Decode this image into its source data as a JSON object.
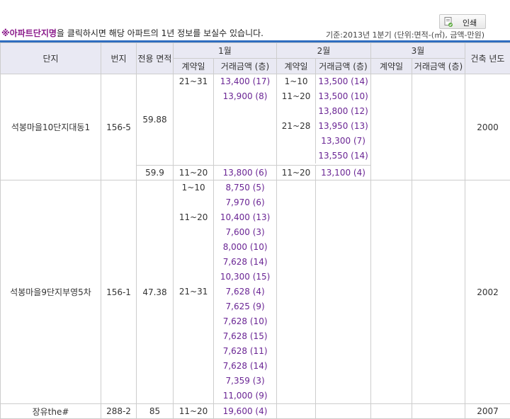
{
  "toolbar": {
    "print_label": "인쇄"
  },
  "notice": {
    "highlight": "※아파트단지명",
    "rest": "을 클릭하시면 해당 아파트의 1년 정보를 보실수 있습니다."
  },
  "basis": {
    "text": "기준:2013년 1분기   (단위:면적-(㎡), 금액-만원)"
  },
  "headers": {
    "complex": "단지",
    "lot": "번지",
    "area": "전용 면적",
    "jan": "1월",
    "feb": "2월",
    "mar": "3월",
    "built": "건축 년도",
    "contract_day": "계약일",
    "price_floor": "거래금액 (층)"
  },
  "rows": {
    "r1": {
      "name": "석봉마을10단지대동1",
      "lot": "156-5",
      "area_a": "59.88",
      "area_b": "59.9",
      "built": "2000",
      "jan_a_day": "21~31",
      "jan_a": [
        "13,400 (17)",
        "13,900 (8)"
      ],
      "feb_a1_day": "1~10",
      "feb_a1": [
        "13,500 (14)"
      ],
      "feb_a2_day": "11~20",
      "feb_a2": [
        "13,500 (10)",
        "13,800 (12)"
      ],
      "feb_a3_day": "21~28",
      "feb_a3": [
        "13,950 (13)",
        "13,300 (7)",
        "13,550 (14)"
      ],
      "jan_b_day": "11~20",
      "jan_b": "13,800 (6)",
      "feb_b_day": "11~20",
      "feb_b": "13,100 (4)"
    },
    "r2": {
      "name": "석봉마을9단지부영5차",
      "lot": "156-1",
      "area": "47.38",
      "built": "2002",
      "jan_1_day": "1~10",
      "jan_1": [
        "8,750 (5)",
        "7,970 (6)"
      ],
      "jan_2_day": "11~20",
      "jan_2": [
        "10,400 (13)",
        "7,600 (3)",
        "8,000 (10)",
        "7,628 (14)",
        "10,300 (15)"
      ],
      "jan_3_day": "21~31",
      "jan_3": [
        "7,628 (4)",
        "7,625 (9)",
        "7,628 (10)",
        "7,628 (15)",
        "7,628 (11)",
        "7,628 (14)",
        "7,359 (3)",
        "11,000 (9)"
      ]
    },
    "r3": {
      "name": "장유the#",
      "lot": "288-2",
      "area": "85",
      "built": "2007",
      "jan_day": "11~20",
      "jan": "19,600 (4)"
    }
  }
}
